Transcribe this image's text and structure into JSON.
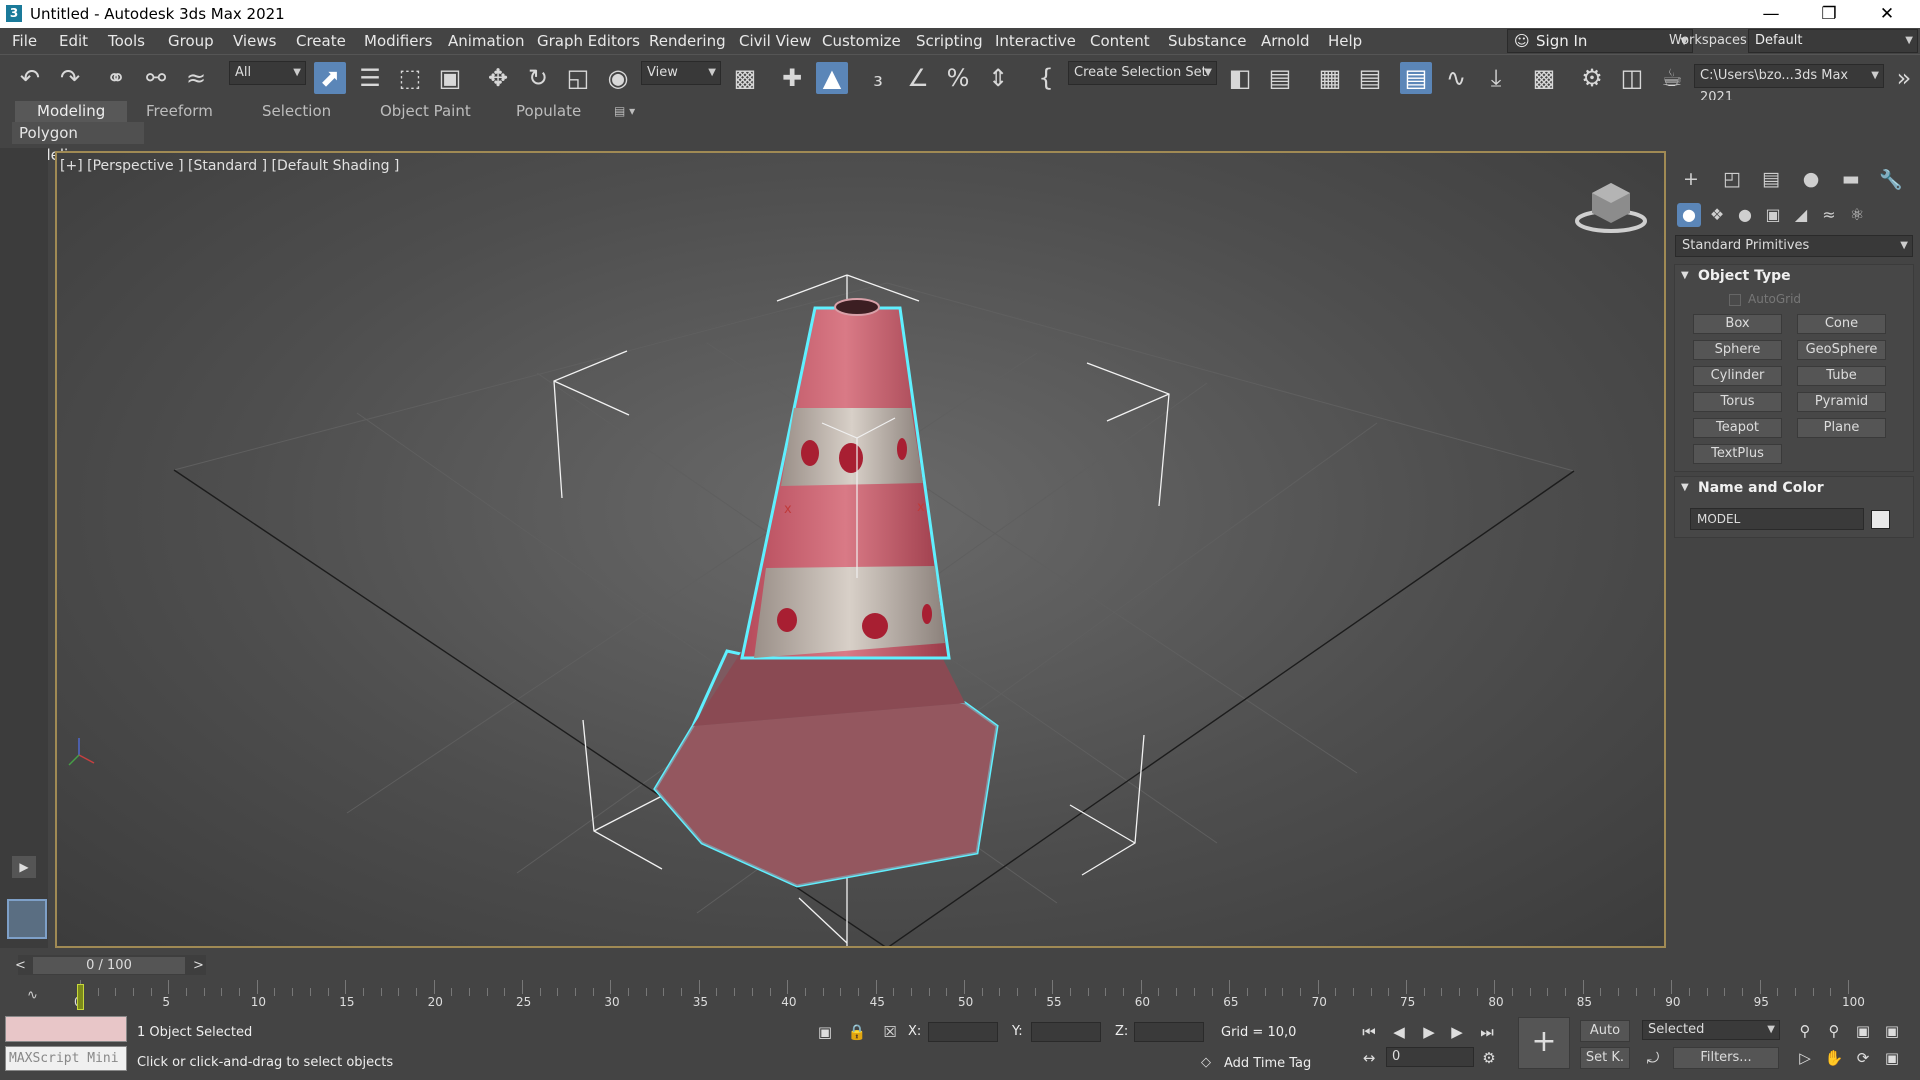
{
  "window": {
    "title": "Untitled - Autodesk 3ds Max 2021",
    "app_icon": "3"
  },
  "menu": [
    "File",
    "Edit",
    "Tools",
    "Group",
    "Views",
    "Create",
    "Modifiers",
    "Animation",
    "Graph Editors",
    "Rendering",
    "Civil View",
    "Customize",
    "Scripting",
    "Interactive",
    "Content",
    "Substance",
    "Arnold",
    "Help"
  ],
  "account": {
    "sign_in": "Sign In",
    "workspaces_label": "Workspaces:",
    "workspace": "Default"
  },
  "toolbar": {
    "selection_filter": "All",
    "ref_coord": "View",
    "selection_set": "Create Selection Set",
    "project_path": "C:\\Users\\bzo...3ds Max 2021"
  },
  "ribbon": {
    "tabs": [
      "Modeling",
      "Freeform",
      "Selection",
      "Object Paint",
      "Populate"
    ],
    "active": "Modeling",
    "sub_label": "Polygon Modeling"
  },
  "viewport": {
    "label": "[+] [Perspective ] [Standard ] [Default Shading ]"
  },
  "command_panel": {
    "category": "Standard Primitives",
    "object_type_title": "Object Type",
    "autogrid": "AutoGrid",
    "buttons": [
      "Box",
      "Cone",
      "Sphere",
      "GeoSphere",
      "Cylinder",
      "Tube",
      "Torus",
      "Pyramid",
      "Teapot",
      "Plane",
      "TextPlus"
    ],
    "name_color_title": "Name and Color",
    "object_name": "MODEL"
  },
  "timeline": {
    "frame_display": "0 / 100",
    "prev": "<",
    "next": ">",
    "ticks": [
      "0",
      "5",
      "10",
      "15",
      "20",
      "25",
      "30",
      "35",
      "40",
      "45",
      "50",
      "55",
      "60",
      "65",
      "70",
      "75",
      "80",
      "85",
      "90",
      "95",
      "100"
    ],
    "current_frame": 0
  },
  "status": {
    "maxscript": "MAXScript Mini",
    "selection": "1 Object Selected",
    "prompt": "Click or click-and-drag to select objects",
    "x_label": "X:",
    "y_label": "Y:",
    "z_label": "Z:",
    "grid": "Grid = 10,0",
    "add_time_tag": "Add Time Tag",
    "auto_key": "Auto",
    "set_key": "Set K.",
    "key_filter": "Selected",
    "filters": "Filters...",
    "frame_value": "0"
  }
}
